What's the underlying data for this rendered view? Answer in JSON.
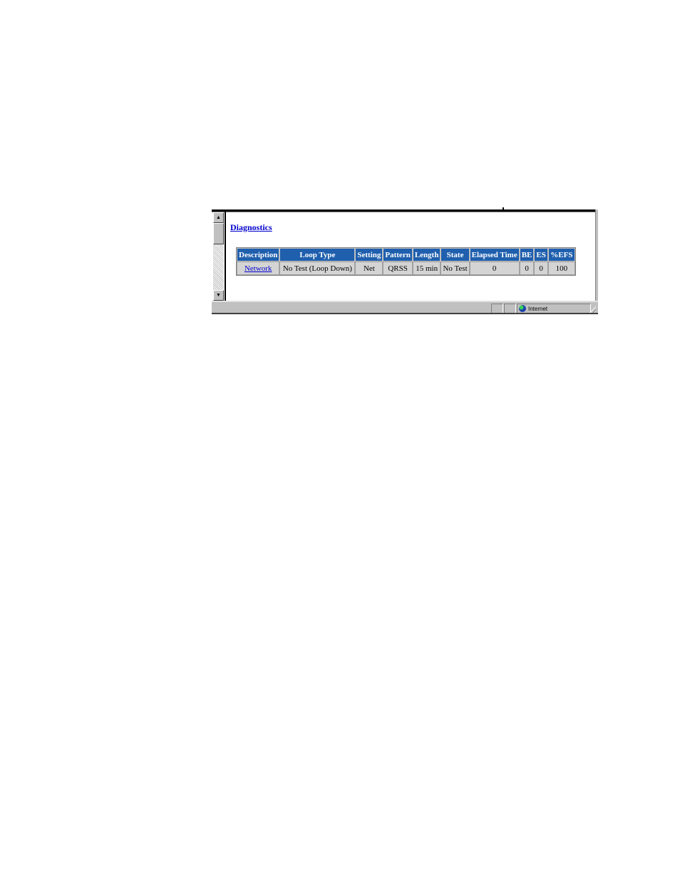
{
  "page": {
    "heading": "Diagnostics"
  },
  "table": {
    "headers": [
      "Description",
      "Loop Type",
      "Setting",
      "Pattern",
      "Length",
      "State",
      "Elapsed Time",
      "BE",
      "ES",
      "%EFS"
    ],
    "rows": [
      [
        "Network",
        "No Test (Loop Down)",
        "Net",
        "QRSS",
        "15 min",
        "No Test",
        "0",
        "0",
        "0",
        "100"
      ]
    ]
  },
  "scrollbar": {
    "up_icon": "▲",
    "down_icon": "▼"
  },
  "statusbar": {
    "zone_label": "Internet",
    "zone_icon": "globe-icon"
  },
  "colors": {
    "header_bg": "#1f5fae",
    "link": "#0000cc",
    "cell_bg": "#d4d4d4"
  }
}
